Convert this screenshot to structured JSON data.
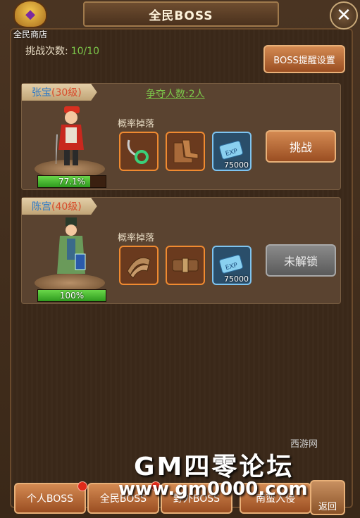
{
  "header": {
    "title": "全民BOSS",
    "shop_label": "全民商店",
    "close": "✕"
  },
  "challenge": {
    "label": "挑战次数:",
    "value": "10/10"
  },
  "remind_button": "BOSS提醒设置",
  "bosses": [
    {
      "name": "张宝",
      "level": "(30级)",
      "compete": "争夺人数:2人",
      "hp_percent": 77.1,
      "hp_text": "77.1%",
      "drop_label": "概率掉落",
      "items": [
        "amulet",
        "boots",
        "exp"
      ],
      "exp_count": "75000",
      "action": "挑战",
      "unlocked": true
    },
    {
      "name": "陈宫",
      "level": "(40级)",
      "compete": "",
      "hp_percent": 100,
      "hp_text": "100%",
      "drop_label": "概率掉落",
      "items": [
        "shoulder",
        "belt",
        "exp"
      ],
      "exp_count": "75000",
      "action": "未解锁",
      "unlocked": false
    }
  ],
  "tabs": [
    {
      "label": "个人BOSS",
      "dot": true
    },
    {
      "label": "全民BOSS",
      "dot": true
    },
    {
      "label": "野外BOSS",
      "dot": false
    },
    {
      "label": "南蛮入侵",
      "dot": false
    }
  ],
  "back_label": "返回",
  "watermark": {
    "line1": "GM四零论坛",
    "line2": "www.gm0000.com",
    "site": "西游网"
  },
  "colors": {
    "accent": "#d48a52",
    "green": "#7cc84a",
    "disabled": "#7a7a7a"
  }
}
